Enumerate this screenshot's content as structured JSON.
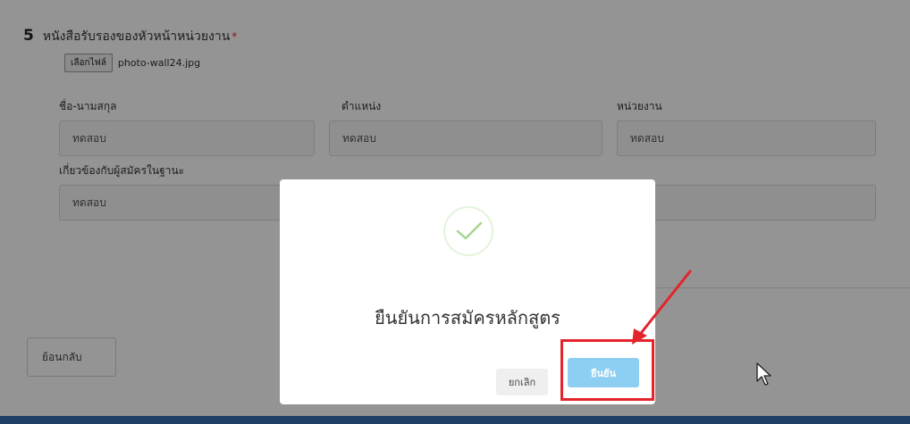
{
  "section": {
    "number": "5",
    "title": "หนังสือรับรองของหัวหน้าหน่วยงาน",
    "required_mark": "*"
  },
  "file": {
    "button_label": "เลือกไฟล์",
    "file_name": "photo-wall24.jpg"
  },
  "fields": {
    "name": {
      "label": "ชื่อ-นามสกุล",
      "value": "ทดสอบ"
    },
    "position": {
      "label": "ตำแหน่ง",
      "value": "ทดสอบ"
    },
    "organization": {
      "label": "หน่วยงาน",
      "value": "ทดสอบ"
    },
    "relation": {
      "label": "เกี่ยวข้องกับผู้สมัครในฐานะ",
      "value": "ทดสอบ"
    }
  },
  "back_button": {
    "label": "ย้อนกลับ"
  },
  "modal": {
    "icon": "check-icon",
    "title": "ยืนยันการสมัครหลักสูตร",
    "cancel_label": "ยกเลิก",
    "confirm_label": "ยืนยัน"
  },
  "colors": {
    "overlay": "#000000",
    "confirm_button": "#8ccff2",
    "highlight": "#e3242b",
    "bottom_bar": "#1f3f66"
  }
}
